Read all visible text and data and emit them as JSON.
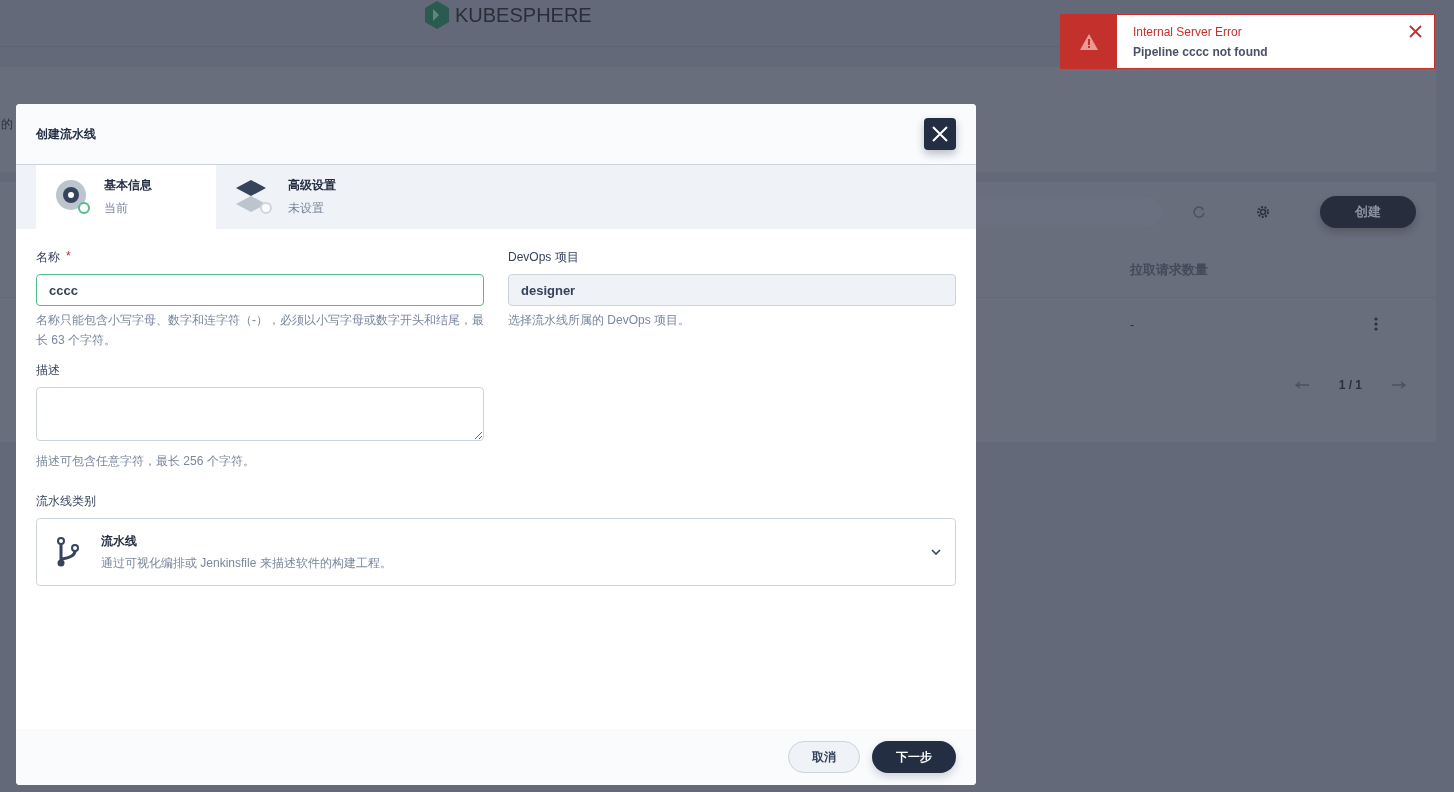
{
  "background": {
    "logo": "KUBESPHERE",
    "cut_text": "的",
    "create_button": "创建",
    "column": "拉取请求数量",
    "cell": "-",
    "pagination": "1 / 1"
  },
  "toast": {
    "title": "Internal Server Error",
    "message": "Pipeline cccc not found"
  },
  "dialog": {
    "title": "创建流水线",
    "steps": [
      {
        "title": "基本信息",
        "status": "当前",
        "selected": true
      },
      {
        "title": "高级设置",
        "status": "未设置",
        "selected": false
      }
    ],
    "name": {
      "label": "名称",
      "required_mark": "*",
      "value": "cccc",
      "hint": "名称只能包含小写字母、数字和连字符（-），必须以小写字母或数字开头和结尾，最长 63 个字符。"
    },
    "project": {
      "label": "DevOps 项目",
      "value": "designer",
      "hint": "选择流水线所属的 DevOps 项目。"
    },
    "description": {
      "label": "描述",
      "hint": "描述可包含任意字符，最长 256 个字符。"
    },
    "type": {
      "label": "流水线类别",
      "title": "流水线",
      "description": "通过可视化编排或 Jenkinsfile 来描述软件的构建工程。"
    },
    "buttons": [
      {
        "label": "取消",
        "kind": "secondary"
      },
      {
        "label": "下一步",
        "kind": "primary"
      }
    ]
  }
}
